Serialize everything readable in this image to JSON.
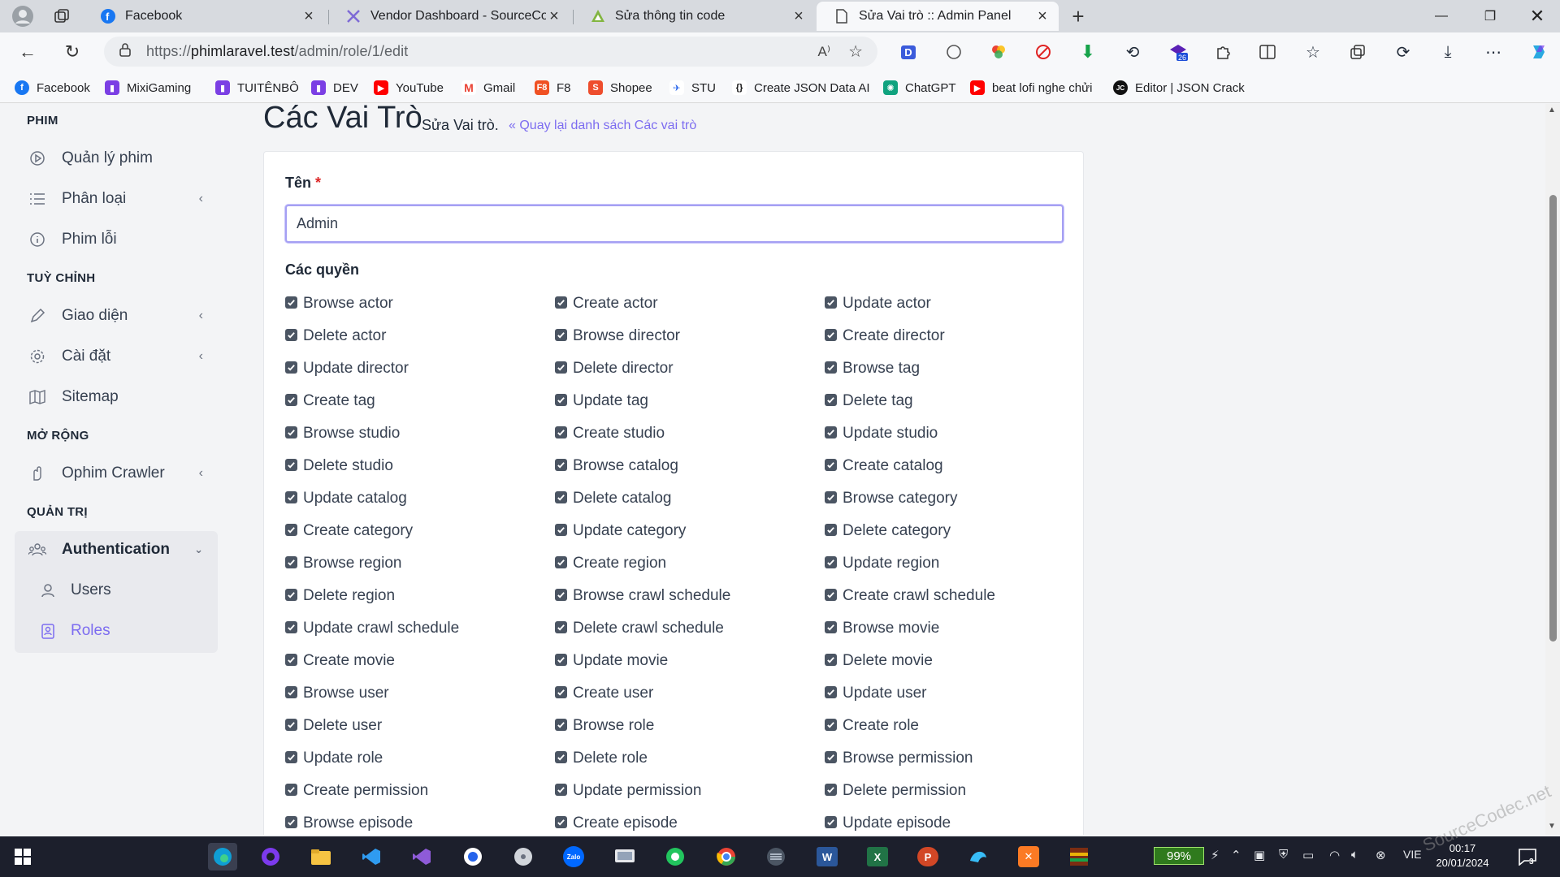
{
  "browser": {
    "tabs": [
      {
        "title": "Facebook",
        "icon": "facebook-icon",
        "color": "#1877f2"
      },
      {
        "title": "Vendor Dashboard - SourceCode",
        "icon": "envato-icon",
        "color": "#7e6ad6"
      },
      {
        "title": "Sửa thông tin code",
        "icon": "code-icon",
        "color": "#82b541"
      },
      {
        "title": "Sửa Vai trò :: Admin Panel",
        "icon": "page-icon",
        "color": "#555555",
        "active": true
      }
    ],
    "url_prefix": "https://",
    "url_domain": "phimlaravel.test",
    "url_path": "/admin/role/1/edit",
    "bookmarks": [
      {
        "label": "Facebook",
        "color": "#1877f2"
      },
      {
        "label": "MixiGaming",
        "color": "#7b3fe4"
      },
      {
        "label": "TUITÊNBÔ",
        "color": "#7b3fe4"
      },
      {
        "label": "DEV",
        "color": "#7b3fe4"
      },
      {
        "label": "YouTube",
        "color": "#ff0000"
      },
      {
        "label": "Gmail",
        "color": "#ea4335"
      },
      {
        "label": "F8",
        "color": "#f05123"
      },
      {
        "label": "Shopee",
        "color": "#ee4d2d"
      },
      {
        "label": "STU",
        "color": "#2563eb"
      },
      {
        "label": "Create JSON Data AI",
        "color": "#111111"
      },
      {
        "label": "ChatGPT",
        "color": "#10a37f"
      },
      {
        "label": "beat lofi nghe chửi",
        "color": "#ff0000"
      },
      {
        "label": "Editor | JSON Crack",
        "color": "#111111"
      }
    ]
  },
  "sidebar": {
    "sections": [
      {
        "heading": "PHIM",
        "items": [
          {
            "label": "Quản lý phim",
            "icon": "play-circle-icon",
            "chevron": false
          },
          {
            "label": "Phân loại",
            "icon": "list-icon",
            "chevron": true
          },
          {
            "label": "Phim lỗi",
            "icon": "info-circle-icon",
            "chevron": false
          }
        ]
      },
      {
        "heading": "TUỲ CHỈNH",
        "items": [
          {
            "label": "Giao diện",
            "icon": "pencil-icon",
            "chevron": true
          },
          {
            "label": "Cài đặt",
            "icon": "gear-icon",
            "chevron": true
          },
          {
            "label": "Sitemap",
            "icon": "map-icon",
            "chevron": false
          }
        ]
      },
      {
        "heading": "MỞ RỘNG",
        "items": [
          {
            "label": "Ophim Crawler",
            "icon": "hand-icon",
            "chevron": true
          }
        ]
      },
      {
        "heading": "QUẢN TRỊ",
        "items": [
          {
            "label": "Authentication",
            "icon": "group-icon",
            "chevron": true,
            "expanded": true,
            "children": [
              {
                "label": "Users",
                "icon": "user-icon"
              },
              {
                "label": "Roles",
                "icon": "badge-icon",
                "active": true
              }
            ]
          }
        ]
      }
    ]
  },
  "header": {
    "title": "Các Vai Trò",
    "subtitle": "Sửa Vai trò.",
    "back_link": "Quay lại danh sách Các vai trò"
  },
  "form": {
    "name_label": "Tên",
    "required_mark": "*",
    "name_value": "Admin",
    "permissions_label": "Các quyền",
    "permissions": [
      "Browse actor",
      "Create actor",
      "Update actor",
      "Delete actor",
      "Browse director",
      "Create director",
      "Update director",
      "Delete director",
      "Browse tag",
      "Create tag",
      "Update tag",
      "Delete tag",
      "Browse studio",
      "Create studio",
      "Update studio",
      "Delete studio",
      "Browse catalog",
      "Create catalog",
      "Update catalog",
      "Delete catalog",
      "Browse category",
      "Create category",
      "Update category",
      "Delete category",
      "Browse region",
      "Create region",
      "Update region",
      "Delete region",
      "Browse crawl schedule",
      "Create crawl schedule",
      "Update crawl schedule",
      "Delete crawl schedule",
      "Browse movie",
      "Create movie",
      "Update movie",
      "Delete movie",
      "Browse user",
      "Create user",
      "Update user",
      "Delete user",
      "Browse role",
      "Create role",
      "Update role",
      "Delete role",
      "Browse permission",
      "Create permission",
      "Update permission",
      "Delete permission",
      "Browse episode",
      "Create episode",
      "Update episode"
    ],
    "all_checked": true
  },
  "taskbar": {
    "battery": "99%",
    "language": "VIE",
    "time": "00:17",
    "date": "20/01/2024",
    "notification_count": "3"
  },
  "watermark": "SourceCodec.net",
  "colors": {
    "accent": "#7c6cf0",
    "input_border": "#a5a0f3",
    "required": "#dc2626"
  }
}
